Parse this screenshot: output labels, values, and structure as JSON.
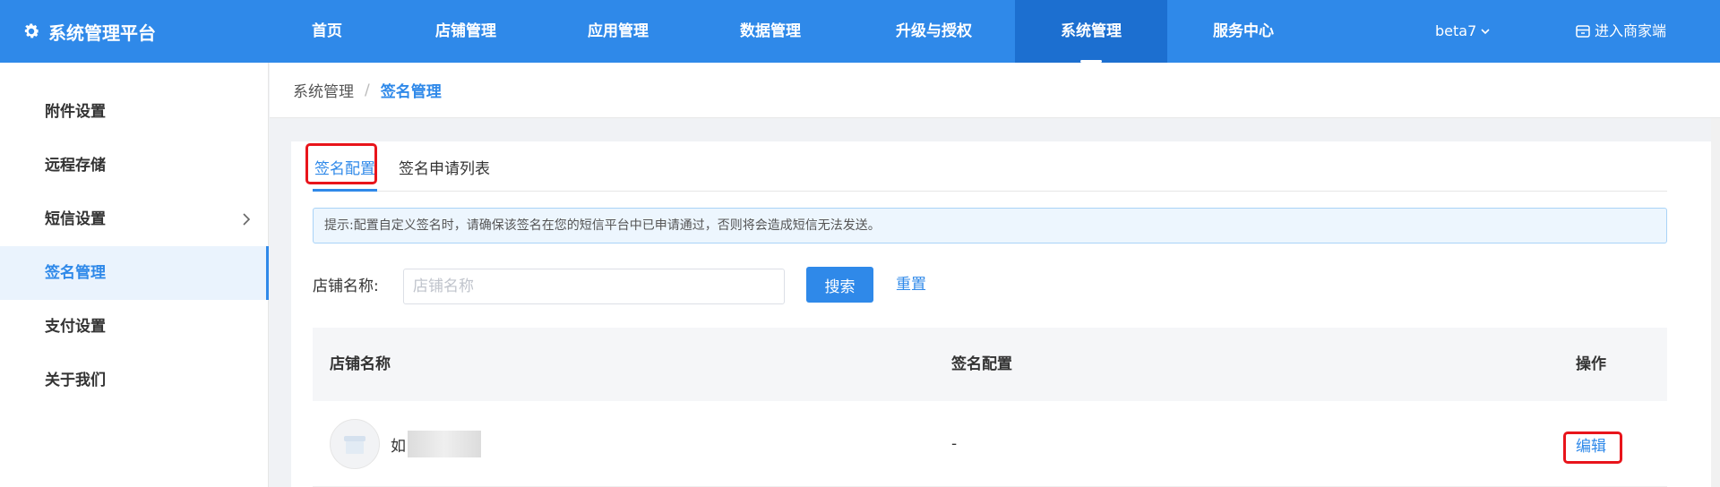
{
  "brand": {
    "title": "系统管理平台",
    "icon": "gear-icon"
  },
  "nav": {
    "items": [
      {
        "label": "首页"
      },
      {
        "label": "店铺管理"
      },
      {
        "label": "应用管理"
      },
      {
        "label": "数据管理"
      },
      {
        "label": "升级与授权"
      },
      {
        "label": "系统管理",
        "active": true
      },
      {
        "label": "服务中心"
      }
    ],
    "version": "beta7",
    "merchant_link": "进入商家端"
  },
  "sidebar": {
    "items": [
      {
        "label": "附件设置"
      },
      {
        "label": "远程存储"
      },
      {
        "label": "短信设置",
        "has_submenu": true
      },
      {
        "label": "签名管理",
        "active": true
      },
      {
        "label": "支付设置"
      },
      {
        "label": "关于我们"
      }
    ]
  },
  "breadcrumb": {
    "root": "系统管理",
    "separator": "/",
    "current": "签名管理"
  },
  "tabs": [
    {
      "label": "签名配置",
      "active": true
    },
    {
      "label": "签名申请列表"
    }
  ],
  "notice": "提示:配置自定义签名时，请确保该签名在您的短信平台中已申请通过，否则将会造成短信无法发送。",
  "filter": {
    "label": "店铺名称:",
    "placeholder": "店铺名称",
    "value": "",
    "search_label": "搜索",
    "reset_label": "重置"
  },
  "table": {
    "columns": [
      "店铺名称",
      "签名配置",
      "操作"
    ],
    "rows": [
      {
        "store_name": "如",
        "signature": "-",
        "action": "编辑"
      }
    ]
  },
  "colors": {
    "primary": "#2f89e9",
    "nav_active": "#1c6fd0",
    "highlight": "#e8141b"
  }
}
